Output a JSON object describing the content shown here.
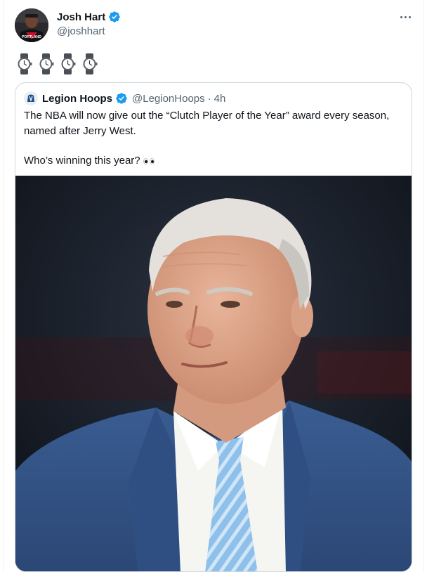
{
  "tweet": {
    "author": {
      "display_name": "Josh Hart",
      "handle": "@joshhart",
      "verified": true,
      "avatar_jersey_text": "PORTLAND"
    },
    "more_icon": "more-horizontal-icon",
    "content_emoji": [
      "watch-icon",
      "watch-icon",
      "watch-icon",
      "watch-icon"
    ]
  },
  "quote": {
    "author": {
      "display_name": "Legion Hoops",
      "handle": "@LegionHoops",
      "verified": true
    },
    "separator": "·",
    "time": "4h",
    "text_line1": "The NBA will now give out the “Clutch Player of the Year” award every season,",
    "text_line2": "named after Jerry West.",
    "text_line3": "Who’s winning this year?",
    "trailing_emoji": "eyes-icon",
    "media_description": "Photo of Jerry West"
  },
  "colors": {
    "verified_blue": "#1d9bf0",
    "text_primary": "#0f1419",
    "text_secondary": "#536471",
    "border": "#cfd9de"
  }
}
